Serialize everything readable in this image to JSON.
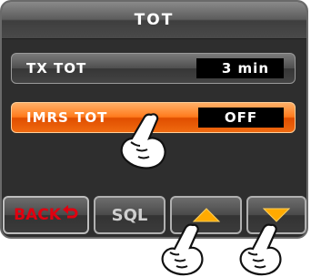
{
  "screen": {
    "title": "TOT"
  },
  "settings": [
    {
      "label": "TX TOT",
      "value": "3 min",
      "selected": false
    },
    {
      "label": "IMRS TOT",
      "value": "OFF",
      "selected": true
    }
  ],
  "buttons": {
    "back": "BACK",
    "sql": "SQL",
    "up_icon": "triangle-up-icon",
    "down_icon": "triangle-down-icon"
  },
  "colors": {
    "selected_row": "#ff7a1c",
    "arrow_triangle": "#ffaa00",
    "back_text": "#e00010"
  }
}
